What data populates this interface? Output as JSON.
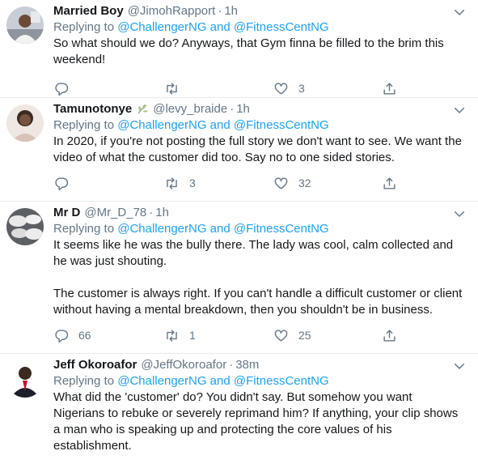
{
  "reply_to": {
    "prefix": "Replying to",
    "mention_1": "@ChallengerNG",
    "joiner": "and",
    "mention_2": "@FitnessCentNG"
  },
  "tweets": [
    {
      "name": "Married Boy",
      "handle": "@JimohRapport",
      "time": "1h",
      "text": [
        "So what should we do? Anyways, that Gym finna be filled to the brim this weekend!"
      ],
      "reply_count": "",
      "retweet_count": "",
      "like_count": "3"
    },
    {
      "name": "Tamunotonye",
      "handle": "@levy_braide",
      "time": "1h",
      "text": [
        "In 2020, if you're not posting the full story we don't want to see. We want the video of what the customer did too. Say no to one sided stories."
      ],
      "reply_count": "",
      "retweet_count": "3",
      "like_count": "32"
    },
    {
      "name": "Mr D",
      "handle": "@Mr_D_78",
      "time": "1h",
      "text": [
        "It seems like he was the bully there. The lady was cool, calm collected and he was just shouting.",
        "The customer is always right. If you can't handle a difficult customer or client without having a mental breakdown, then you shouldn't be in business."
      ],
      "reply_count": "66",
      "retweet_count": "1",
      "like_count": "25"
    },
    {
      "name": "Jeff Okoroafor",
      "handle": "@JeffOkoroafor",
      "time": "38m",
      "text": [
        "What did the 'customer' do? You didn't say. But somehow you want Nigerians to rebuke or severely reprimand him? If anything, your clip shows a man who is speaking up and protecting the core values of his establishment."
      ],
      "reply_count": "",
      "retweet_count": "",
      "like_count": ""
    }
  ],
  "icons": {
    "reply": "reply-icon",
    "retweet": "retweet-icon",
    "like": "heart-icon",
    "share": "share-icon",
    "more": "chevron-down-icon",
    "badge": "leaf-icon"
  },
  "colors": {
    "link": "#1da1f2",
    "muted": "#657786",
    "text": "#14171a",
    "border": "#e6ecf0"
  }
}
